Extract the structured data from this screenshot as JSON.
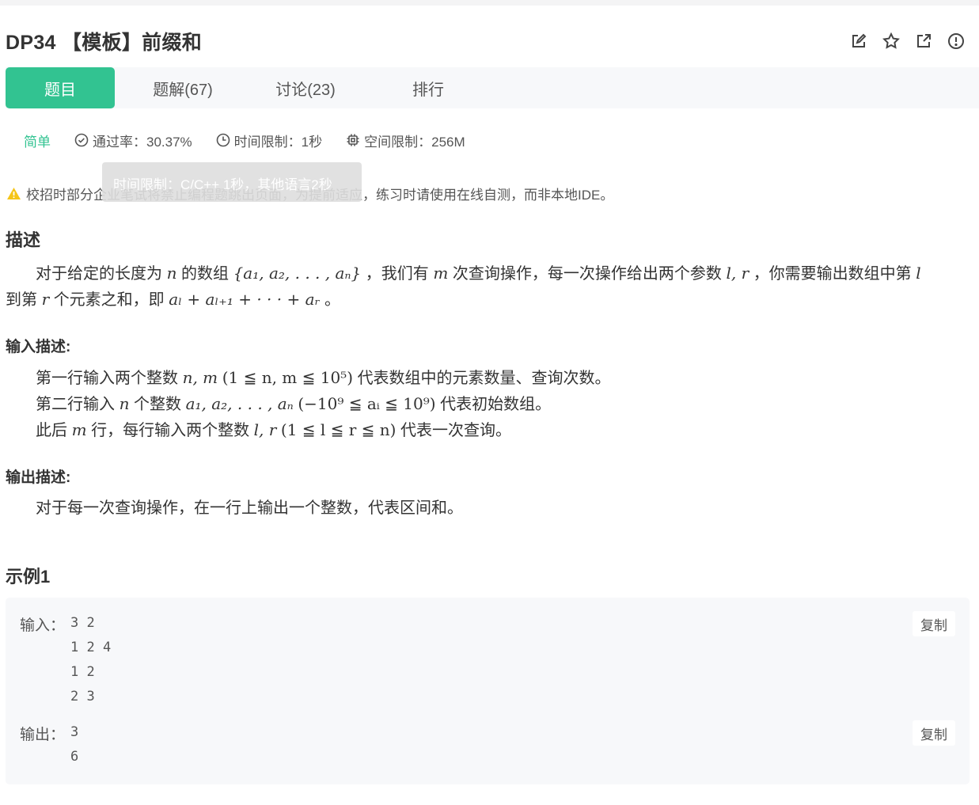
{
  "header": {
    "title": "DP34 【模板】前缀和",
    "tool_icons": [
      "edit-icon",
      "star-icon",
      "external-link-icon",
      "alert-circle-icon"
    ]
  },
  "tabs": [
    {
      "label": "题目"
    },
    {
      "label": "题解(67)"
    },
    {
      "label": "讨论(23)"
    },
    {
      "label": "排行"
    }
  ],
  "meta": {
    "difficulty": "简单",
    "pass_rate": "通过率：30.37%",
    "time_limit": "时间限制：1秒",
    "space_limit": "空间限制：256M"
  },
  "tooltip": "时间限制：C/C++ 1秒，其他语言2秒",
  "warning": "校招时部分企业笔试将禁止编程题跳出页面，为提前适应，练习时请使用在线自测，而非本地IDE。",
  "colors": {
    "accent": "#32c391",
    "warning": "#f5c518"
  },
  "description": {
    "heading": "描述",
    "line1": {
      "t1": "对于给定的长度为",
      "n": "n",
      "t2": "的数组",
      "arr": "{a₁, a₂, . . . , aₙ}",
      "t3": "，我们有",
      "m": "m",
      "t4": "次查询操作，每一次操作给出两个参数",
      "lr": "l, r",
      "t5": "，你需要输出数组中第",
      "l": "l"
    },
    "line2": {
      "t1": "到第",
      "r": "r",
      "t2": "个元素之和，即",
      "sum": "aₗ + aₗ₊₁ + · · · + aᵣ",
      "t3": "。"
    }
  },
  "input_desc": {
    "heading": "输入描述:",
    "l1": {
      "t1": "第一行输入两个整数",
      "vars": "n, m",
      "cond": "(1 ≦ n, m ≦ 10⁵)",
      "t2": "代表数组中的元素数量、查询次数。"
    },
    "l2": {
      "t1": "第二行输入",
      "n": "n",
      "t2": "个整数",
      "arr": "a₁, a₂, . . . , aₙ",
      "cond": "(−10⁹ ≦ aᵢ ≦ 10⁹)",
      "t3": "代表初始数组。"
    },
    "l3": {
      "t1": "此后",
      "m": "m",
      "t2": "行，每行输入两个整数",
      "lr": "l, r",
      "cond": "(1 ≦ l ≦ r ≦ n)",
      "t3": "代表一次查询。"
    }
  },
  "output_desc": {
    "heading": "输出描述:",
    "text": "对于每一次查询操作，在一行上输出一个整数，代表区间和。"
  },
  "example": {
    "heading": "示例1",
    "input_label": "输入：",
    "input": "3 2\n1 2 4\n1 2\n2 3",
    "output_label": "输出：",
    "output": "3\n6",
    "copy_label": "复制"
  }
}
